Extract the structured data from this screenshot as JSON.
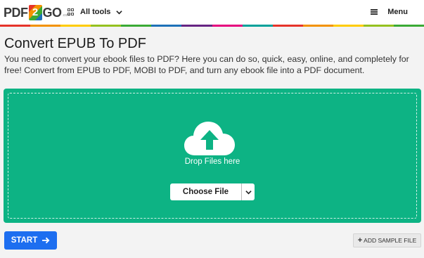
{
  "header": {
    "logo": {
      "part1": "PDF",
      "part2": "2",
      "part3": "GO",
      "sub": ".com"
    },
    "all_tools_label": "All tools",
    "menu_label": "Menu",
    "strip_colors": [
      "#e6332a",
      "#f39200",
      "#ffcc00",
      "#95c11f",
      "#3aaa35",
      "#1d71b8",
      "#662483",
      "#e6007e",
      "#00a19a",
      "#e6332a",
      "#f39200",
      "#ffcc00",
      "#95c11f",
      "#3aaa35"
    ]
  },
  "main": {
    "title": "Convert EPUB To PDF",
    "description": "You need to convert your ebook files to PDF? Here you can do so, quick, easy, online, and completely for free! Convert from EPUB to PDF, MOBI to PDF, and turn any ebook file into a PDF document."
  },
  "dropzone": {
    "icon": "cloud-upload-icon",
    "drop_text": "Drop Files here",
    "choose_label": "Choose File",
    "bg_color": "#0db384"
  },
  "actions": {
    "start_label": "START",
    "sample_label": "ADD SAMPLE FILE",
    "start_color": "#1d6ef0"
  }
}
